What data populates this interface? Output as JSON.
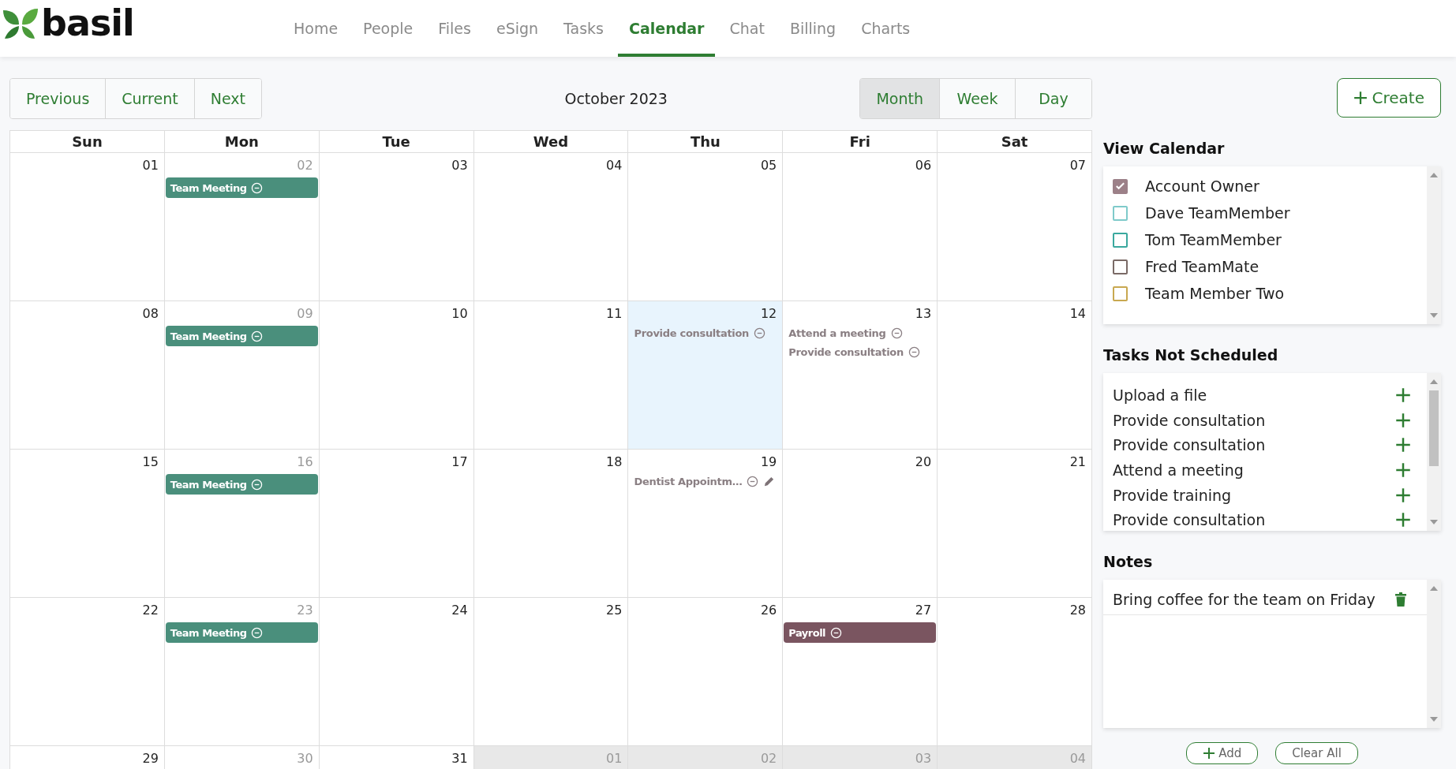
{
  "logo": {
    "text": "basil"
  },
  "nav": [
    {
      "label": "Home",
      "selected": false
    },
    {
      "label": "People",
      "selected": false
    },
    {
      "label": "Files",
      "selected": false
    },
    {
      "label": "eSign",
      "selected": false
    },
    {
      "label": "Tasks",
      "selected": false
    },
    {
      "label": "Calendar",
      "selected": true
    },
    {
      "label": "Chat",
      "selected": false
    },
    {
      "label": "Billing",
      "selected": false
    },
    {
      "label": "Charts",
      "selected": false
    }
  ],
  "toolbar": {
    "nav_buttons": [
      "Previous",
      "Current",
      "Next"
    ],
    "title": "October 2023",
    "views": [
      {
        "label": "Month",
        "selected": true
      },
      {
        "label": "Week",
        "selected": false
      },
      {
        "label": "Day",
        "selected": false
      }
    ],
    "create_button": "Create"
  },
  "calendar": {
    "weekdays": [
      "Sun",
      "Mon",
      "Tue",
      "Wed",
      "Thu",
      "Fri",
      "Sat"
    ],
    "weeks": [
      [
        {
          "day": "01",
          "dim": false,
          "outside": false,
          "today": false
        },
        {
          "day": "02",
          "dim": true,
          "outside": false,
          "today": false,
          "events": [
            {
              "kind": "bar",
              "title": "Team Meeting",
              "color": "#4a8f7c",
              "editable": false
            }
          ]
        },
        {
          "day": "03",
          "dim": false,
          "outside": false,
          "today": false
        },
        {
          "day": "04",
          "dim": false,
          "outside": false,
          "today": false
        },
        {
          "day": "05",
          "dim": false,
          "outside": false,
          "today": false
        },
        {
          "day": "06",
          "dim": false,
          "outside": false,
          "today": false
        },
        {
          "day": "07",
          "dim": false,
          "outside": false,
          "today": false
        }
      ],
      [
        {
          "day": "08",
          "dim": false,
          "outside": false,
          "today": false
        },
        {
          "day": "09",
          "dim": true,
          "outside": false,
          "today": false,
          "events": [
            {
              "kind": "bar",
              "title": "Team Meeting",
              "color": "#4a8f7c",
              "editable": false
            }
          ]
        },
        {
          "day": "10",
          "dim": false,
          "outside": false,
          "today": false
        },
        {
          "day": "11",
          "dim": false,
          "outside": false,
          "today": false
        },
        {
          "day": "12",
          "dim": false,
          "outside": false,
          "today": true,
          "events": [
            {
              "kind": "text",
              "title": "Provide consultation",
              "editable": false
            }
          ]
        },
        {
          "day": "13",
          "dim": false,
          "outside": false,
          "today": false,
          "events": [
            {
              "kind": "text",
              "title": "Attend a meeting",
              "editable": false
            },
            {
              "kind": "text",
              "title": "Provide consultation",
              "editable": false
            }
          ]
        },
        {
          "day": "14",
          "dim": false,
          "outside": false,
          "today": false
        }
      ],
      [
        {
          "day": "15",
          "dim": false,
          "outside": false,
          "today": false
        },
        {
          "day": "16",
          "dim": true,
          "outside": false,
          "today": false,
          "events": [
            {
              "kind": "bar",
              "title": "Team Meeting",
              "color": "#4a8f7c",
              "editable": false
            }
          ]
        },
        {
          "day": "17",
          "dim": false,
          "outside": false,
          "today": false
        },
        {
          "day": "18",
          "dim": false,
          "outside": false,
          "today": false
        },
        {
          "day": "19",
          "dim": false,
          "outside": false,
          "today": false,
          "events": [
            {
              "kind": "text",
              "title": "Dentist Appointm…",
              "editable": true
            }
          ]
        },
        {
          "day": "20",
          "dim": false,
          "outside": false,
          "today": false
        },
        {
          "day": "21",
          "dim": false,
          "outside": false,
          "today": false
        }
      ],
      [
        {
          "day": "22",
          "dim": false,
          "outside": false,
          "today": false
        },
        {
          "day": "23",
          "dim": true,
          "outside": false,
          "today": false,
          "events": [
            {
              "kind": "bar",
              "title": "Team Meeting",
              "color": "#4a8f7c",
              "editable": false
            }
          ]
        },
        {
          "day": "24",
          "dim": false,
          "outside": false,
          "today": false
        },
        {
          "day": "25",
          "dim": false,
          "outside": false,
          "today": false
        },
        {
          "day": "26",
          "dim": false,
          "outside": false,
          "today": false
        },
        {
          "day": "27",
          "dim": false,
          "outside": false,
          "today": false,
          "events": [
            {
              "kind": "bar",
              "title": "Payroll",
              "color": "#7a5560",
              "editable": false
            }
          ]
        },
        {
          "day": "28",
          "dim": false,
          "outside": false,
          "today": false
        }
      ],
      [
        {
          "day": "29",
          "dim": false,
          "outside": false,
          "today": false
        },
        {
          "day": "30",
          "dim": true,
          "outside": false,
          "today": false
        },
        {
          "day": "31",
          "dim": false,
          "outside": false,
          "today": false
        },
        {
          "day": "01",
          "dim": false,
          "outside": true,
          "today": false
        },
        {
          "day": "02",
          "dim": false,
          "outside": true,
          "today": false
        },
        {
          "day": "03",
          "dim": false,
          "outside": true,
          "today": false
        },
        {
          "day": "04",
          "dim": false,
          "outside": true,
          "today": false
        }
      ]
    ]
  },
  "view_calendar": {
    "title": "View Calendar",
    "members": [
      {
        "name": "Account Owner",
        "checked": true,
        "color": "#9c8088"
      },
      {
        "name": "Dave TeamMember",
        "checked": false,
        "color": "#7fcaca"
      },
      {
        "name": "Tom TeamMember",
        "checked": false,
        "color": "#3aa89e"
      },
      {
        "name": "Fred TeamMate",
        "checked": false,
        "color": "#7a6a66"
      },
      {
        "name": "Team Member Two",
        "checked": false,
        "color": "#c8a850"
      }
    ]
  },
  "tasks": {
    "title": "Tasks Not Scheduled",
    "items": [
      "Upload a file",
      "Provide consultation",
      "Provide consultation",
      "Attend a meeting",
      "Provide training",
      "Provide consultation"
    ]
  },
  "notes": {
    "title": "Notes",
    "items": [
      "Bring coffee for the team on Friday"
    ],
    "add_button": "Add",
    "clear_button": "Clear All"
  }
}
